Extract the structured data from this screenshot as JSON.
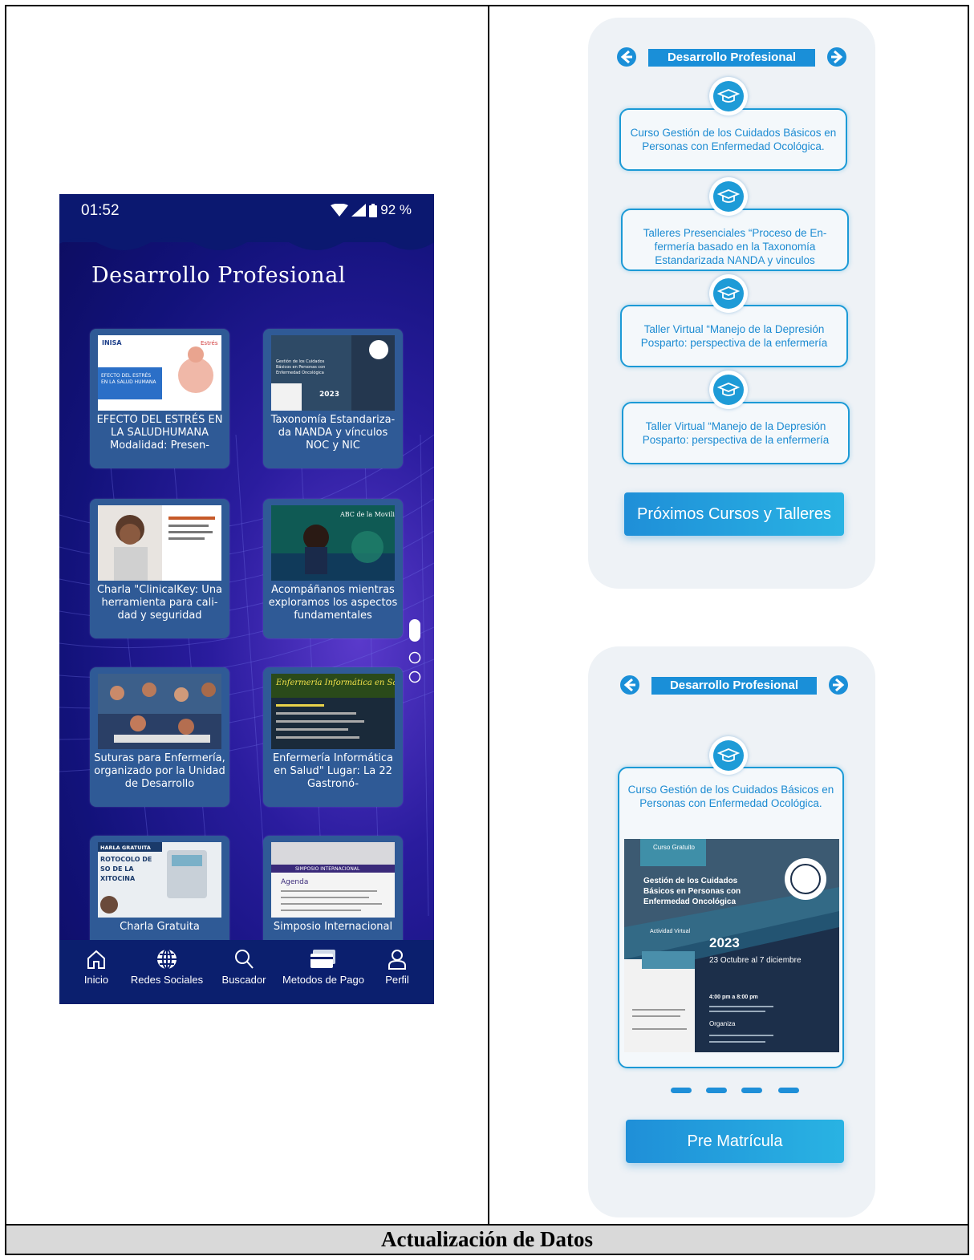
{
  "left_phone": {
    "status": {
      "time": "01:52",
      "battery": "92 %"
    },
    "title": "Desarrollo Profesional",
    "cards": [
      {
        "caption": "EFECTO DEL ESTRÉS EN LA SALUDHUMANA Modalidad: Presen-",
        "thumb_brand": "INISA",
        "thumb_title": "EFECTO DEL ESTRÉS EN LA SALUD HUMANA",
        "thumb_tag": "Estrés"
      },
      {
        "caption": "Taxonomía Estandariza-da NANDA y vínculos NOC y NIC",
        "thumb_title": "Gestión de los Cuidados Básicos en Personas con Enfermedad Oncológica",
        "thumb_year": "2023"
      },
      {
        "caption": "Charla \"ClinicalKey: Una herramienta para cali-dad y seguridad"
      },
      {
        "caption": "Acompáñanos mientras exploramos los aspectos fundamentales",
        "thumb_title": "ABC de la Movilidad Eléctrica"
      },
      {
        "caption": "Suturas para Enfermería, organizado  por la Unidad de Desarrollo"
      },
      {
        "caption": "Enfermería Informática en Salud\" Lugar: La 22 Gastronó-",
        "thumb_title": "Enfermería Informática en Salud"
      },
      {
        "caption": "Charla Gratuita",
        "thumb_title": "CHARLA GRATUITA PROTOCOLO DE USO DE LA OXITOCINA"
      },
      {
        "caption": "Simposio Internacional",
        "thumb_title": "SIMPOSIO INTERNACIONAL",
        "thumb_sub": "Agenda"
      }
    ],
    "nav": [
      {
        "label": "Inicio",
        "icon": "home-icon"
      },
      {
        "label": "Redes Sociales",
        "icon": "globe-icon"
      },
      {
        "label": "Buscador",
        "icon": "search-icon"
      },
      {
        "label": "Metodos de Pago",
        "icon": "card-icon"
      },
      {
        "label": "Perfil",
        "icon": "user-icon"
      }
    ]
  },
  "top_mockup": {
    "header": "Desarrollo Profesional",
    "courses": [
      "Curso Gestión de los Cuidados Básicos en Personas con Enfermedad Ocológica.",
      "Talleres Presenciales “Proceso de En-fermería basado en la Taxonomía Estandarizada NANDA y vinculos",
      "Taller Virtual “Manejo de la Depresión Posparto: perspectiva de la enfermería",
      "Taller Virtual “Manejo de la Depresión Posparto: perspectiva de la enfermería"
    ],
    "button": "Próximos Cursos y Talleres"
  },
  "bottom_mockup": {
    "header": "Desarrollo Profesional",
    "course": "Curso Gestión de los Cuidados Básicos en Personas con Enfermedad Ocológica.",
    "poster": {
      "tag": "Curso Gratuito",
      "title": "Gestión de los Cuidados Básicos en Personas con Enfermedad Oncológica",
      "mode": "Actividad Virtual",
      "year": "2023",
      "dates": "23 Octubre al 7 diciembre",
      "time": "4:00 pm a 8:00 pm",
      "org": "Organiza"
    },
    "button": "Pre Matrícula"
  },
  "footer": "Actualización de Datos",
  "colors": {
    "accent": "#1c9ad6",
    "phone_bg": "#12127a",
    "nav_bg": "#0b1f6e"
  }
}
